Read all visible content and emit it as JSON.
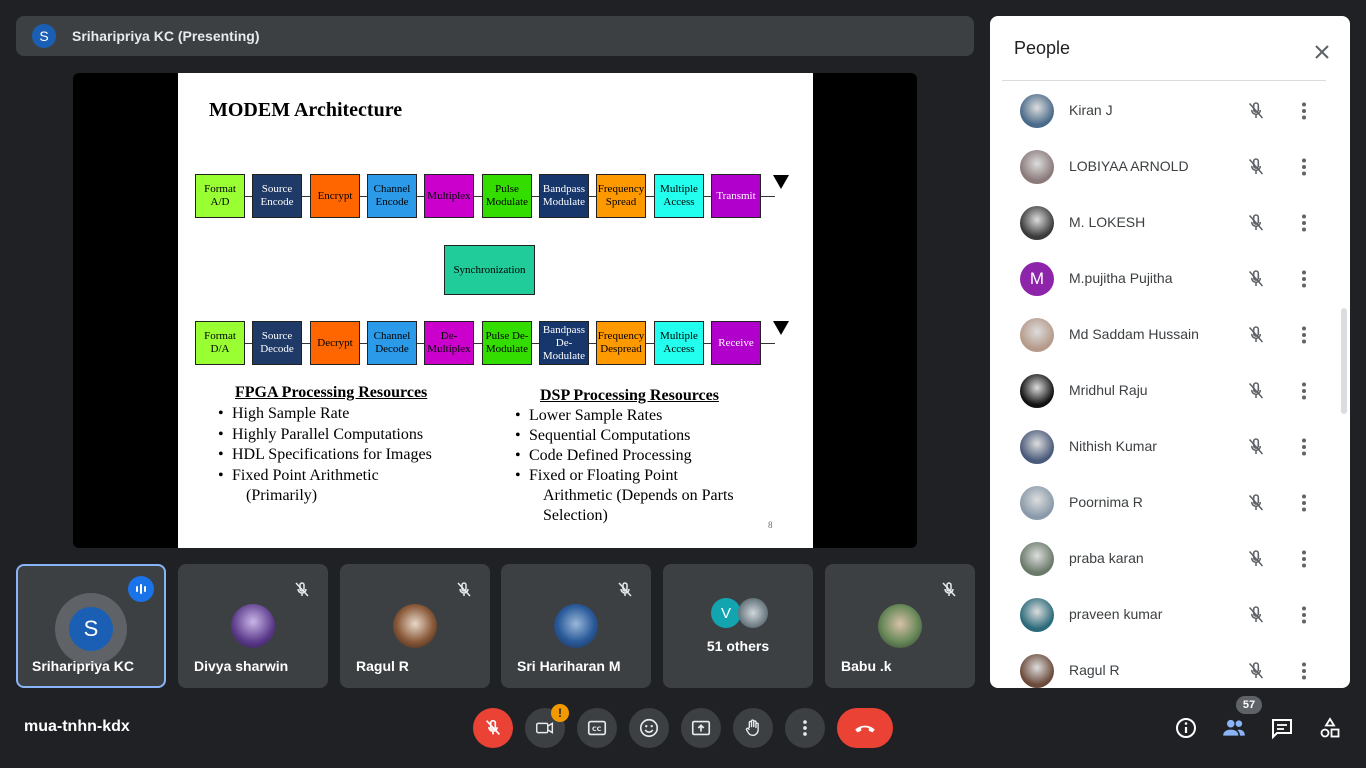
{
  "presenting_bar": {
    "avatar_letter": "S",
    "title": "Sriharipriya KC (Presenting)"
  },
  "slide": {
    "title": "MODEM Architecture",
    "tx_blocks": [
      "Format A/D",
      "Source Encode",
      "Encrypt",
      "Channel Encode",
      "Multiplex",
      "Pulse Modulate",
      "Bandpass Modulate",
      "Frequency Spread",
      "Multiple Access",
      "Transmit"
    ],
    "rx_blocks": [
      "Format D/A",
      "Source Decode",
      "Decrypt",
      "Channel Decode",
      "De-Multiplex",
      "Pulse De-Modulate",
      "Bandpass De-Modulate",
      "Frequency Despread",
      "Multiple Access",
      "Receive"
    ],
    "block_colors": [
      "#99ff33",
      "#1f3a66",
      "#ff6600",
      "#2b9ae8",
      "#cc00cc",
      "#33dd00",
      "#17366b",
      "#ff9900",
      "#22ffee",
      "#b100cc"
    ],
    "sync": "Synchronization",
    "fpga_head": "FPGA Processing Resources",
    "fpga_items": [
      "High Sample Rate",
      "Highly Parallel Computations",
      "HDL Specifications for Images",
      "Fixed Point Arithmetic",
      "(Primarily)"
    ],
    "dsp_head": "DSP Processing Resources",
    "dsp_items": [
      "Lower Sample Rates",
      "Sequential Computations",
      "Code Defined Processing",
      "Fixed or Floating Point",
      "Arithmetic (Depends on Parts",
      "Selection)"
    ],
    "page": "8"
  },
  "tiles": [
    {
      "name": "Sriharipriya KC",
      "letter": "S"
    },
    {
      "name": "Divya sharwin"
    },
    {
      "name": "Ragul R"
    },
    {
      "name": "Sri Hariharan M"
    },
    {
      "name": "51 others",
      "letter": "V"
    },
    {
      "name": "Babu .k"
    }
  ],
  "bottom": {
    "meeting_code": "mua-tnhn-kdx",
    "camera_badge": "!",
    "participants_count": "57"
  },
  "people_panel": {
    "title": "People",
    "people": [
      {
        "name": "Kiran J",
        "color": "#4a6a8a"
      },
      {
        "name": "LOBIYAA ARNOLD",
        "color": "#8a7a7a"
      },
      {
        "name": "M. LOKESH",
        "color": "#3a3a3a"
      },
      {
        "name": "M.pujitha Pujitha",
        "color": "#8e24aa",
        "letter": "M"
      },
      {
        "name": "Md Saddam Hussain",
        "color": "#b59a8a"
      },
      {
        "name": "Mridhul Raju",
        "color": "#111111"
      },
      {
        "name": "Nithish Kumar",
        "color": "#4a5a7a"
      },
      {
        "name": "Poornima R",
        "color": "#8a9aaa"
      },
      {
        "name": "praba karan",
        "color": "#6a7a6a"
      },
      {
        "name": "praveen kumar",
        "color": "#2a6a7a"
      },
      {
        "name": "Ragul R",
        "color": "#6a4a3a"
      }
    ]
  }
}
